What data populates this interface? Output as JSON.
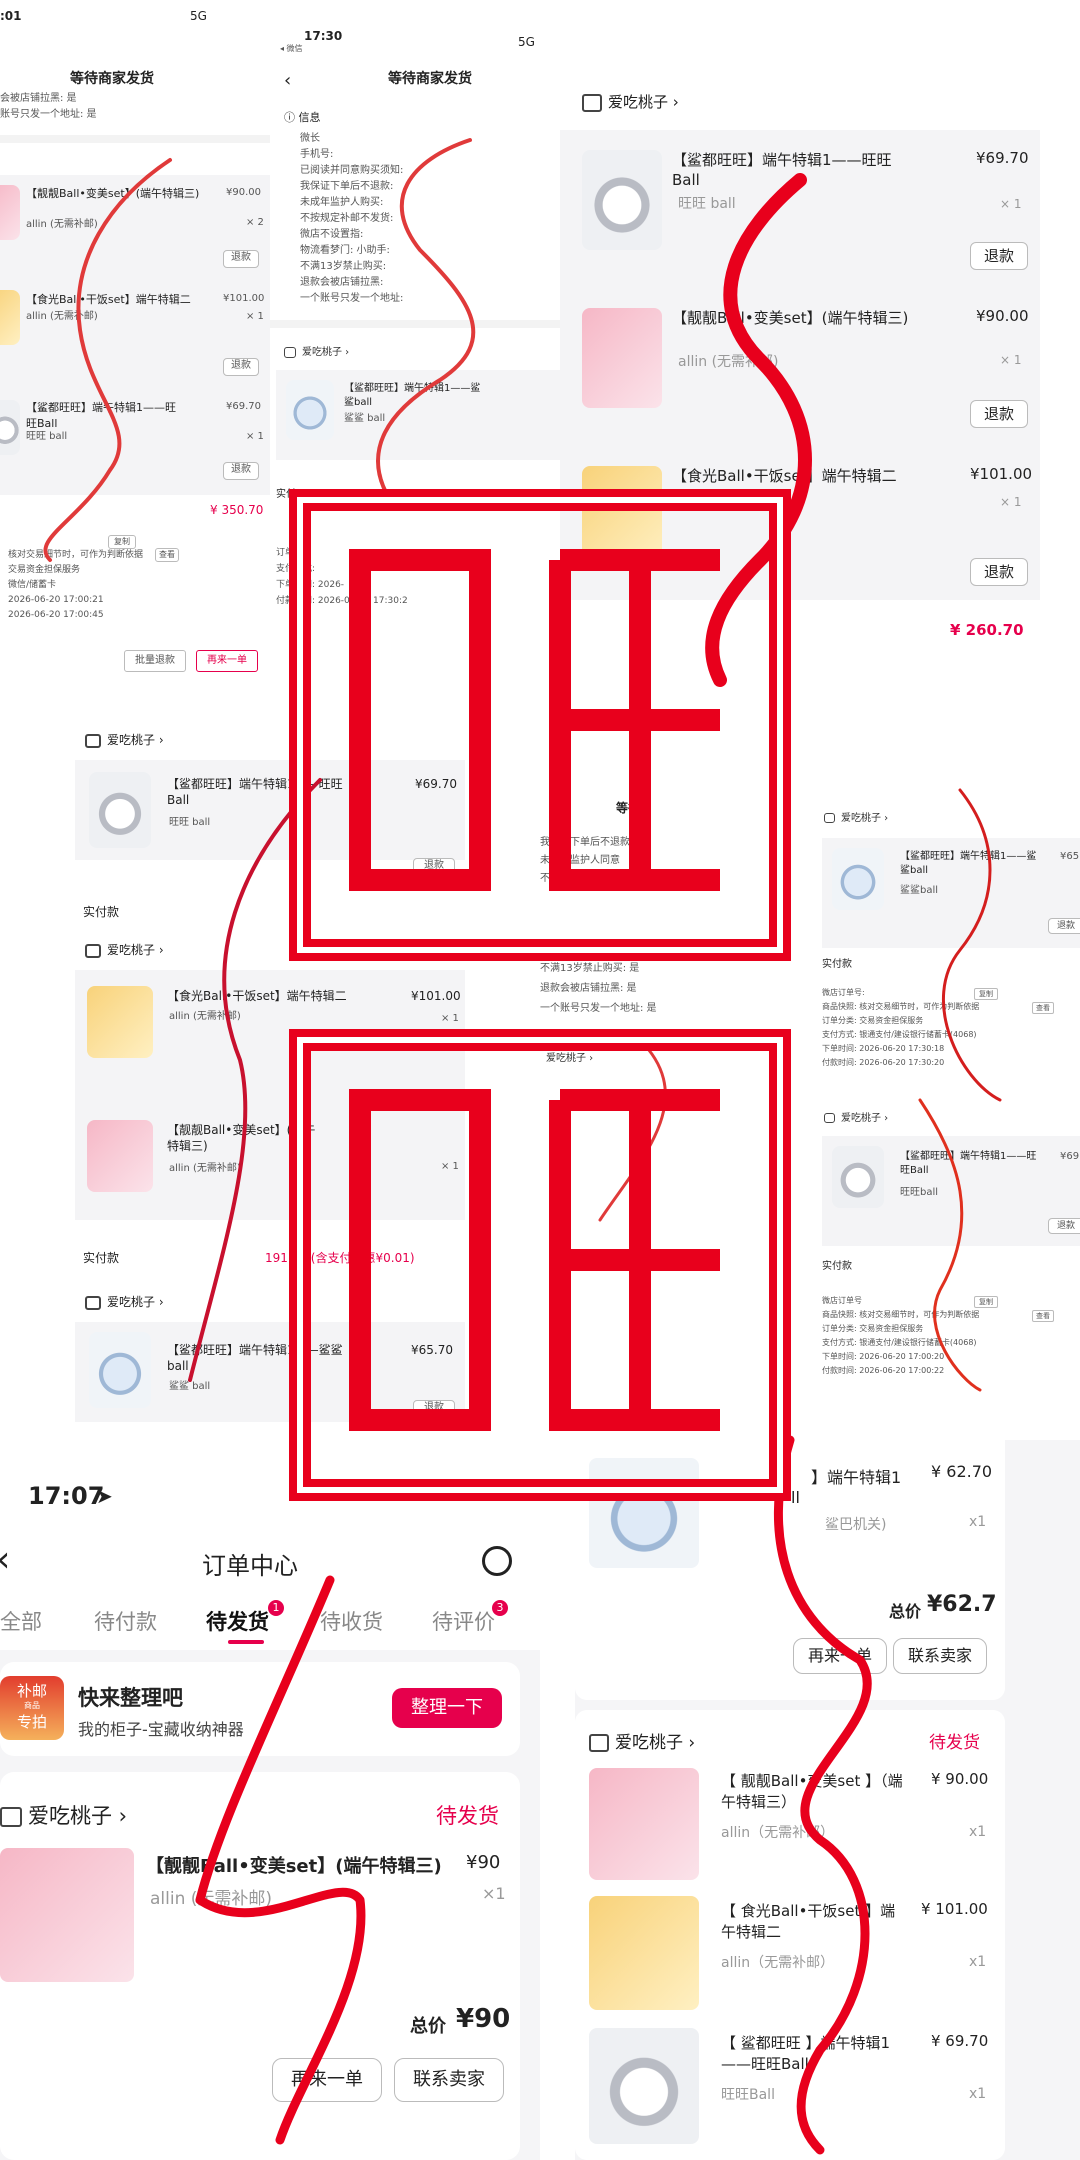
{
  "shop": "爱吃桃子",
  "panelA": {
    "status_time": ":01",
    "network": "5G",
    "title": "等待商家发货",
    "lines": [
      "会被店铺拉黑: 是",
      "账号只发一个地址: 是"
    ],
    "items": [
      {
        "name": "【靓靓Ball•变美set】(端午特辑三)",
        "sub": "allin (无需补邮)",
        "price": "¥90.00",
        "qty": "× 2",
        "btn": "退款"
      },
      {
        "name": "【食光Ball•干饭set】端午特辑二",
        "sub": "allin (无需补邮)",
        "price": "¥101.00",
        "qty": "× 1",
        "btn": "退款"
      },
      {
        "name": "【鲨都旺旺】端午特辑1——旺旺Ball",
        "sub": "旺旺 ball",
        "price": "¥69.70",
        "qty": "× 1",
        "btn": "退款"
      }
    ],
    "total": "¥ 350.70",
    "copy": "复制",
    "look": "查看",
    "info": [
      "核对交易细节时，可作为判断依据",
      "交易资金担保服务",
      "微信/储蓄卡",
      "2026-06-20 17:00:21",
      "2026-06-20 17:00:45"
    ],
    "btn_batch": "批量退款",
    "btn_again": "再来一单"
  },
  "panelB": {
    "status_time": "17:30",
    "back_app": "◂ 微信",
    "network": "5G",
    "title": "等待商家发货",
    "section": "信息",
    "lines": [
      "微长",
      "手机号:",
      "已阅读并同意购买须知:",
      "我保证下单后不退款:",
      "未成年监护人购买:",
      "不按规定补邮不发货:",
      "微店不设置指:",
      "物流看梦门: 小助手:",
      "不满13岁禁止购买:",
      "退款会被店铺拉黑:",
      "一个账号只发一个地址:"
    ],
    "item": {
      "name": "【鲨都旺旺】端午特辑1——鲨鲨ball",
      "sub": "鲨鲨 ball"
    },
    "label_paid": "实付",
    "info": [
      "订单分",
      "支付方式:",
      "下单时间: 2026-",
      "付款时间: 2026-06-20 17:30:2"
    ]
  },
  "panelC": {
    "items": [
      {
        "name": "【鲨都旺旺】端午特辑1——旺旺Ball",
        "sub": "旺旺 ball",
        "price": "¥69.70",
        "qty": "× 1",
        "btn": "退款"
      },
      {
        "name": "【靓靓Ball•变美set】(端午特辑三)",
        "sub": "allin (无需补邮)",
        "price": "¥90.00",
        "qty": "× 1",
        "btn": "退款"
      },
      {
        "name": "【食光Ball•干饭set】端午特辑二",
        "sub": "allin (无需补邮)",
        "price": "¥101.00",
        "qty": "× 1",
        "btn": "退款"
      }
    ],
    "total": "¥ 260.70"
  },
  "panelD": {
    "item1": {
      "name": "【鲨都旺旺】端午特辑1——旺旺Ball",
      "sub": "旺旺 ball",
      "price": "¥69.70",
      "btn": "退款"
    },
    "paid_label": "实付款",
    "item2": {
      "name": "【食光Ball•干饭set】端午特辑二",
      "sub": "allin (无需补邮)",
      "price": "¥101.00",
      "qty": "× 1"
    },
    "item3": {
      "name": "【靓靓Ball•变美set】(端午特辑三)",
      "sub": "allin (无需补邮)",
      "qty": "× 1"
    },
    "paid_value": "191.00 (含支付优惠¥0.01)",
    "item4": {
      "name": "【鲨都旺旺】端午特辑1——鲨鲨ball",
      "sub": "鲨鲨 ball",
      "price": "¥65.70",
      "btn": "退款"
    }
  },
  "panelE": {
    "title": "等待",
    "lines": [
      "我保证下单后不退款",
      "未成年监护人同意",
      "不按规定补邮不发货",
      "不满13岁禁止购买: 是",
      "退款会被店铺拉黑: 是",
      "一个账号只发一个地址: 是"
    ]
  },
  "panelF": {
    "item1": {
      "name": "【鲨都旺旺】端午特辑1——鲨鲨ball",
      "sub": "鲨鲨ball",
      "price": "¥65",
      "btn": "退款"
    },
    "paid_label": "实付款",
    "copy": "复制",
    "look": "查看",
    "info1": [
      "微店订单号:",
      "商品快照: 核对交易细节时，可作为判断依据",
      "订单分类: 交易资金担保服务",
      "支付方式: 银通支付/建设银行储蓄卡(4068)",
      "下单时间: 2026-06-20 17:30:18",
      "付款时间: 2026-06-20 17:30:20"
    ],
    "item2": {
      "name": "【鲨都旺旺】端午特辑1——旺旺Ball",
      "sub": "旺旺ball",
      "price": "¥69",
      "btn": "退款"
    },
    "info2": [
      "微店订单号",
      "商品快照: 核对交易细节时，可作为判断依据",
      "订单分类: 交易资金担保服务",
      "支付方式: 银通支付/建设银行储蓄卡(4068)",
      "下单时间: 2026-06-20 17:00:20",
      "付款时间: 2026-06-20 17:00:22"
    ]
  },
  "panelG": {
    "time": "17:07",
    "title": "订单中心",
    "tabs": [
      "全部",
      "待付款",
      "待发货",
      "待收货",
      "待评价"
    ],
    "badge_ship": "1",
    "badge_review": "3",
    "promo_badge_top": "补邮",
    "promo_badge_mid": "商品",
    "promo_badge_bottom": "专拍",
    "promo_title": "快来整理吧",
    "promo_sub": "我的柜子-宝藏收纳神器",
    "promo_btn": "整理一下",
    "status": "待发货",
    "item": {
      "name": "【靓靓Ball•变美set】(端午特辑三)",
      "sub": "allin (无需补邮)",
      "price": "¥90",
      "qty": "×1"
    },
    "total_label": "总价",
    "total_value": "¥90",
    "btn_again": "再来一单",
    "btn_contact": "联系卖家"
  },
  "panelH": {
    "top_item": {
      "name": "】端午特辑1",
      "name2": "ll",
      "sub": "鲨巴机关)",
      "price": "¥ 62.70",
      "qty": "x1"
    },
    "total_label": "总价",
    "total_value": "¥62.7",
    "btn_again": "再来一单",
    "btn_contact": "联系卖家",
    "status": "待发货",
    "items": [
      {
        "name": "【 靓靓Ball•变美set 】（端午特辑三）",
        "sub": "allin（无需补邮）",
        "price": "¥ 90.00",
        "qty": "x1"
      },
      {
        "name": "【 食光Ball•干饭set 】端午特辑二",
        "sub": "allin（无需补邮）",
        "price": "¥ 101.00",
        "qty": "x1"
      },
      {
        "name": "【 鲨都旺旺 】端午特辑1——旺旺Ball",
        "sub": "旺旺Ball",
        "price": "¥ 69.70",
        "qty": "x1"
      }
    ]
  }
}
